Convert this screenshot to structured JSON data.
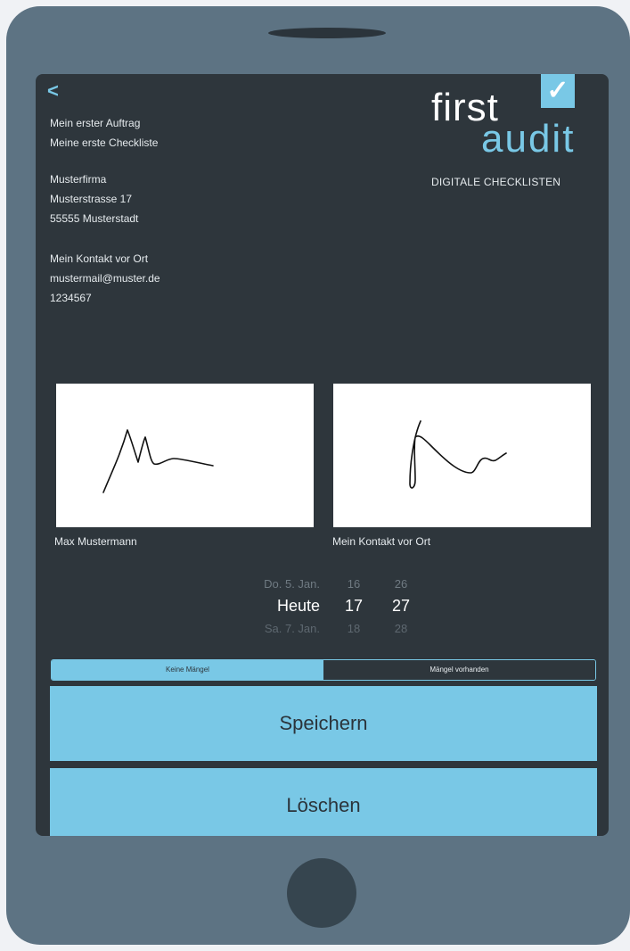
{
  "nav": {
    "back_label": "<"
  },
  "order": {
    "name": "Mein erster Auftrag",
    "checklist": "Meine erste Checkliste"
  },
  "company": {
    "name": "Musterfirma",
    "street": "Musterstrasse 17",
    "city": "55555 Musterstadt"
  },
  "contact": {
    "name": "Mein Kontakt vor Ort",
    "email": "mustermail@muster.de",
    "phone": "1234567"
  },
  "logo": {
    "word1": "first",
    "word2": "audit",
    "tagline": "DIGITALE CHECKLISTEN",
    "check": "✓"
  },
  "signatures": [
    {
      "label": "Max Mustermann"
    },
    {
      "label": "Mein Kontakt vor Ort"
    }
  ],
  "date_picker": {
    "rows": [
      {
        "date": "Do. 5. Jan.",
        "hour": "16",
        "minute": "26"
      },
      {
        "date": "Heute",
        "hour": "17",
        "minute": "27"
      },
      {
        "date": "Sa. 7. Jan.",
        "hour": "18",
        "minute": "28"
      }
    ]
  },
  "segment": {
    "option1": "Keine Mängel",
    "option2": "Mängel vorhanden",
    "selected": "Keine Mängel"
  },
  "buttons": {
    "save": "Speichern",
    "delete": "Löschen"
  },
  "colors": {
    "accent": "#79c8e6",
    "screen_bg": "#2e363c",
    "device": "#5d7383"
  }
}
